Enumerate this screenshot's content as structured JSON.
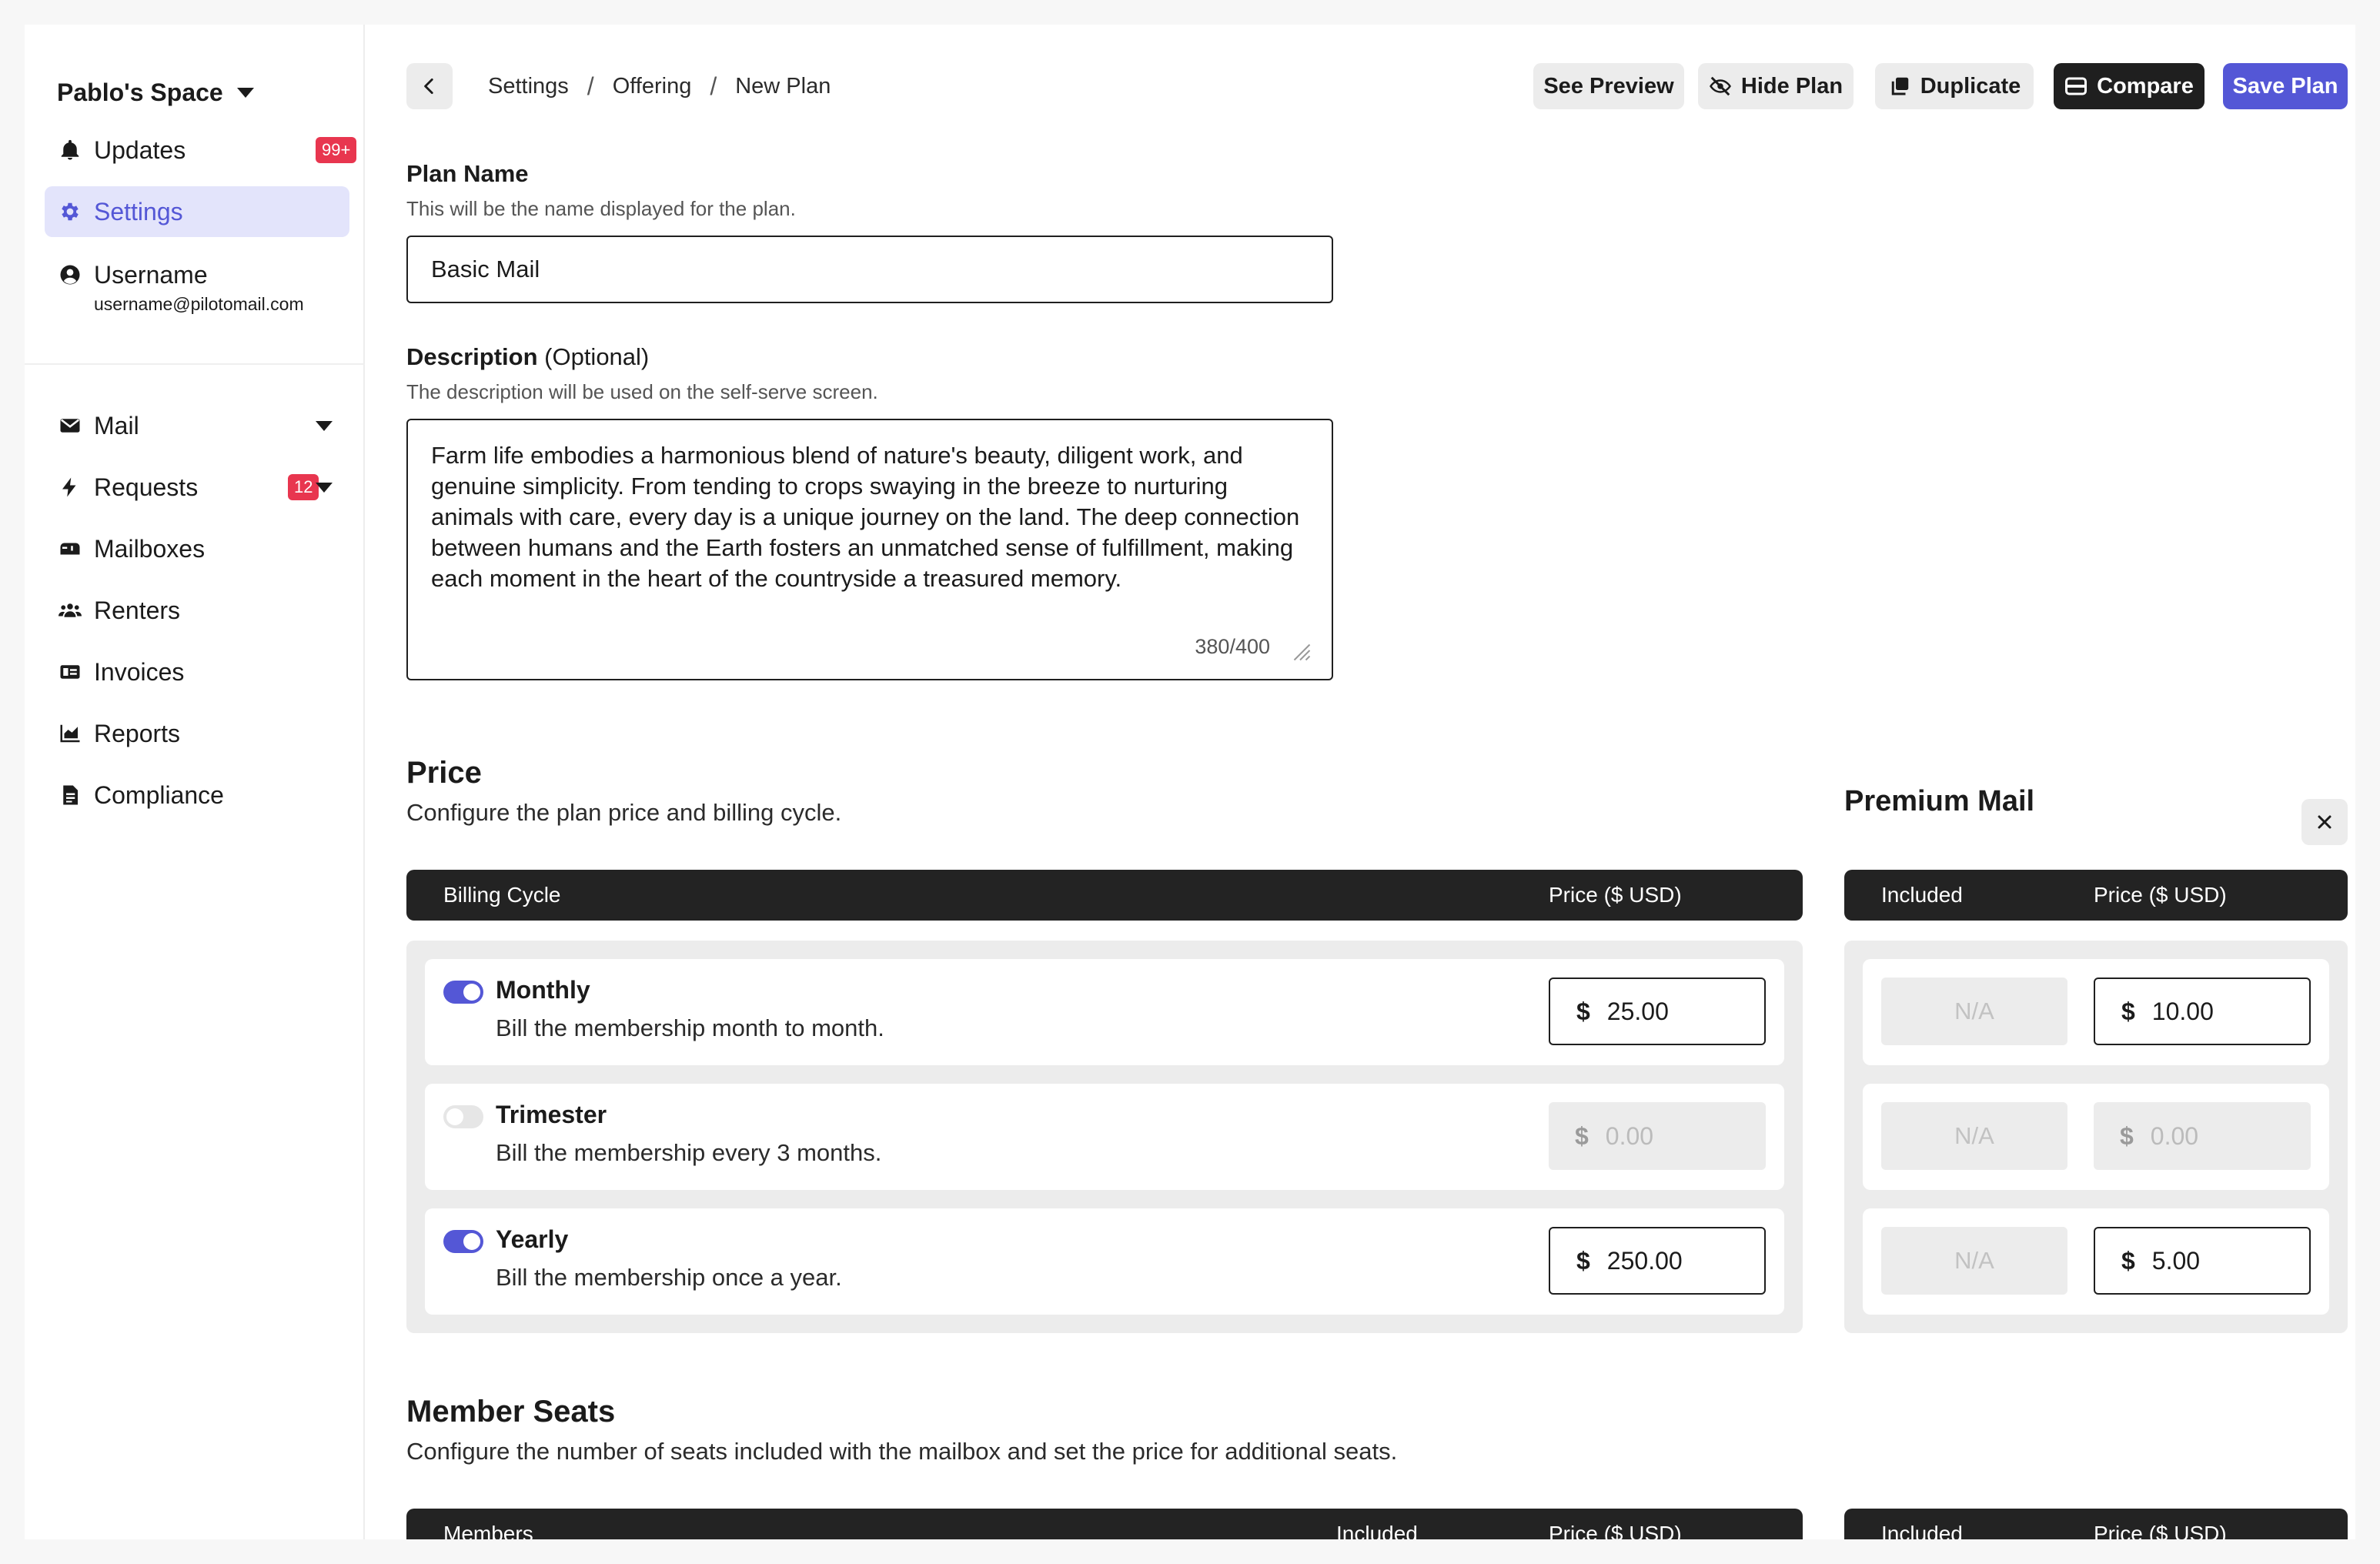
{
  "sidebar": {
    "space_name": "Pablo's Space",
    "items": [
      {
        "label": "Updates",
        "badge": "99+"
      },
      {
        "label": "Settings"
      },
      {
        "label": "Username",
        "sub": "username@pilotomail.com"
      },
      {
        "label": "Mail"
      },
      {
        "label": "Requests",
        "badge": "12"
      },
      {
        "label": "Mailboxes"
      },
      {
        "label": "Renters"
      },
      {
        "label": "Invoices"
      },
      {
        "label": "Reports"
      },
      {
        "label": "Compliance"
      }
    ]
  },
  "header": {
    "breadcrumb": [
      "Settings",
      "Offering",
      "New Plan"
    ],
    "buttons": {
      "preview": "See Preview",
      "hide": "Hide Plan",
      "duplicate": "Duplicate",
      "compare": "Compare",
      "save": "Save Plan"
    }
  },
  "form": {
    "plan_name_label": "Plan Name",
    "plan_name_help": "This will be the name displayed for the plan.",
    "plan_name_value": "Basic Mail",
    "description_label": "Description",
    "description_optional": " (Optional)",
    "description_help": "The description will be used on the self-serve screen.",
    "description_value": "Farm life embodies a harmonious blend of nature's beauty, diligent work, and genuine simplicity. From tending to crops swaying in the breeze to nurturing animals with care, every day is a unique journey on the land. The deep connection between humans and the Earth fosters an unmatched sense of fulfillment, making each moment in the heart of the countryside a treasured memory.",
    "description_counter": "380/400"
  },
  "price": {
    "title": "Price",
    "subtitle": "Configure the plan price and billing cycle.",
    "col_cycle": "Billing Cycle",
    "col_price": "Price ($ USD)",
    "currency": "$",
    "rows": [
      {
        "name": "Monthly",
        "desc": "Bill the membership month to month.",
        "enabled": true,
        "price": "25.00"
      },
      {
        "name": "Trimester",
        "desc": "Bill the membership every 3 months.",
        "enabled": false,
        "price": "0.00"
      },
      {
        "name": "Yearly",
        "desc": "Bill the membership once a year.",
        "enabled": true,
        "price": "250.00"
      }
    ]
  },
  "compare": {
    "title": "Premium Mail",
    "col_included": "Included",
    "col_price": "Price ($ USD)",
    "na": "N/A",
    "rows": [
      {
        "price": "10.00",
        "enabled": true
      },
      {
        "price": "0.00",
        "enabled": false
      },
      {
        "price": "5.00",
        "enabled": true
      }
    ]
  },
  "seats": {
    "title": "Member Seats",
    "subtitle": "Configure the number of seats included with the mailbox and set the price for additional seats.",
    "col_members": "Members",
    "col_included": "Included",
    "col_price": "Price ($ USD)",
    "compare_col_included": "Included",
    "compare_col_price": "Price ($ USD)"
  },
  "colors": {
    "accent": "#5457d6",
    "accent_soft": "#e3e4fb",
    "badge": "#e8364f",
    "dark": "#232323"
  }
}
